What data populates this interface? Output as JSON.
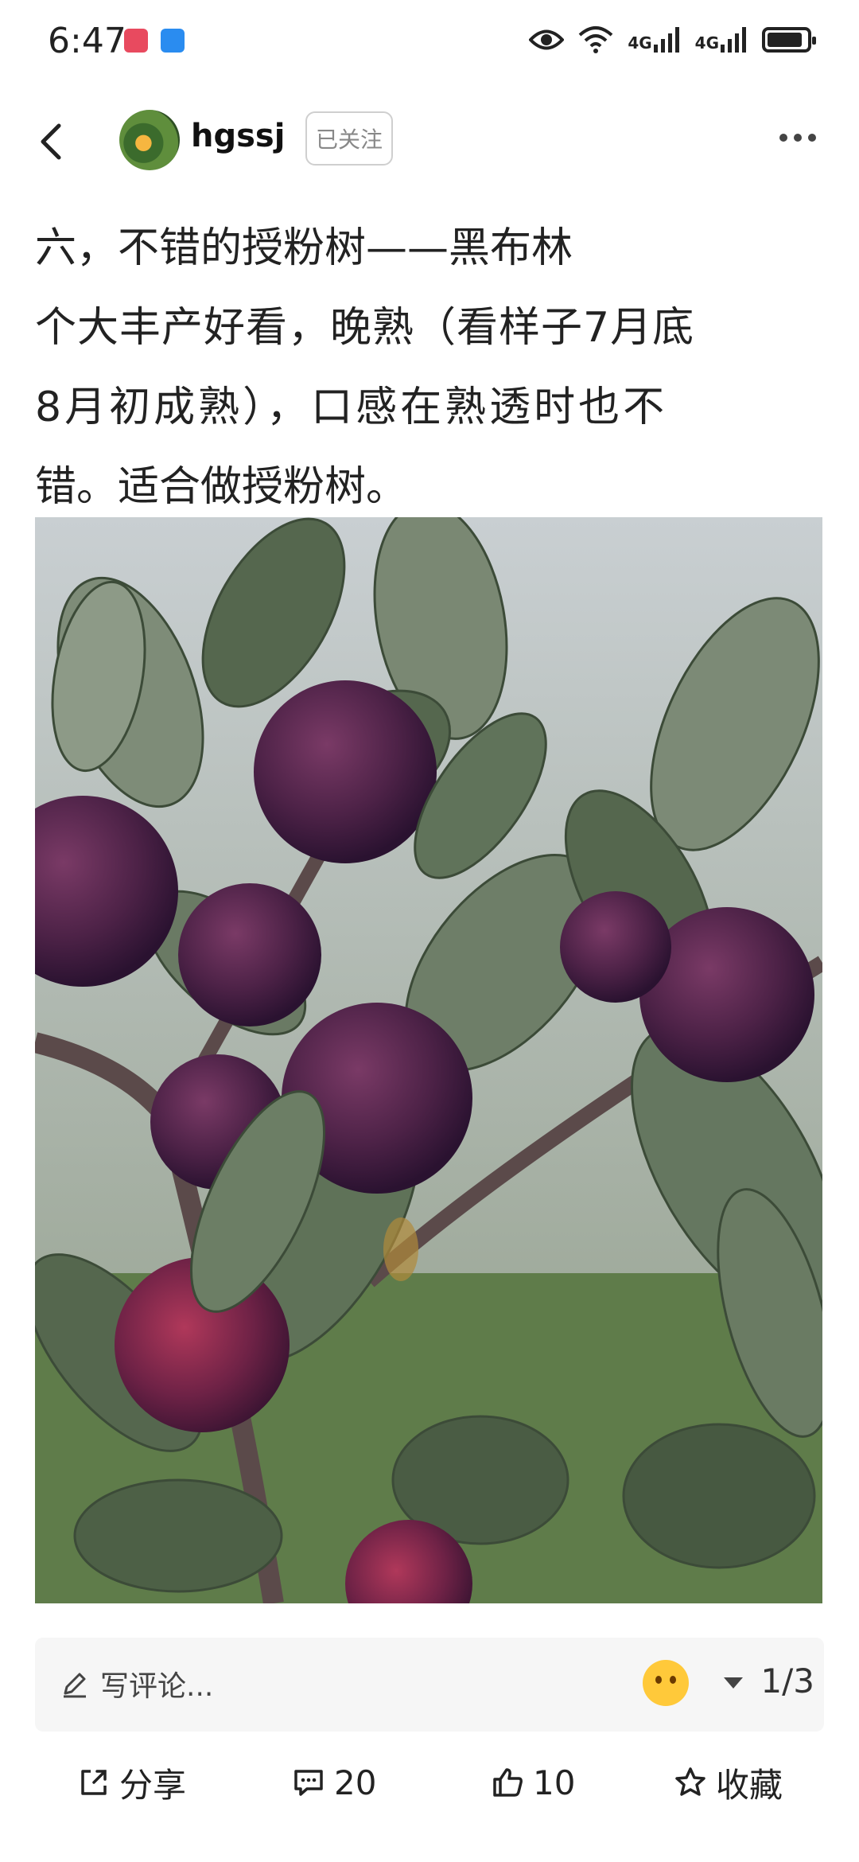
{
  "status_bar": {
    "time": "6:47",
    "network1": "4G",
    "network2": "4G",
    "battery_level": 0.9
  },
  "header": {
    "username": "hgssj",
    "follow_label": "已关注"
  },
  "post": {
    "lines": [
      "六，不错的授粉树——黑布林",
      "个大丰产好看，晚熟（看样子7月底",
      "8月初成熟），口感在熟透时也不",
      "错。适合做授粉树。"
    ]
  },
  "comment_bar": {
    "placeholder": "写评论...",
    "pager": "1/3"
  },
  "actions": {
    "share_label": "分享",
    "comments_count": "20",
    "likes_count": "10",
    "favorite_label": "收藏"
  },
  "colors": {
    "text": "#222222",
    "muted": "#888888",
    "comment_bg": "#f6f6f6"
  }
}
